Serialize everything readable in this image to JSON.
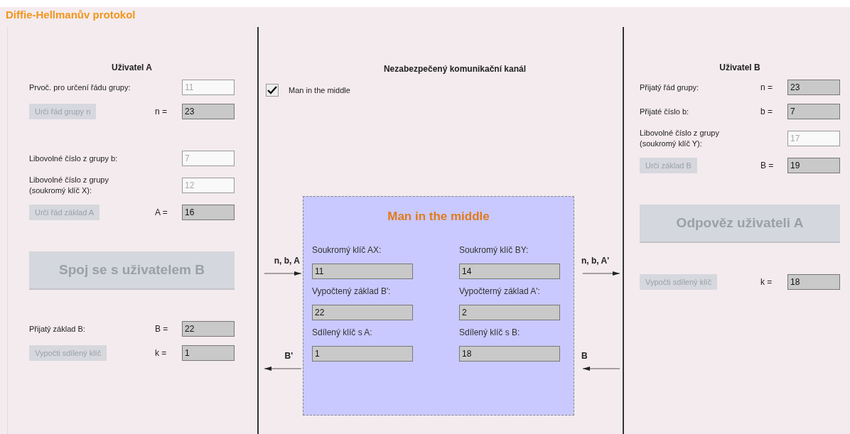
{
  "title": "Diffie-Hellmanův protokol",
  "user_a": {
    "heading": "Uživatel A",
    "sections": [
      [
        {
          "kind": "field",
          "label": "Prvoč. pro určení řádu grupy:",
          "value": "11",
          "editable": true
        },
        {
          "kind": "action",
          "button": "Urči řád grupy n",
          "disabled": true,
          "var": "n =",
          "value": "23",
          "editable": false
        }
      ],
      [
        {
          "kind": "field",
          "label": "Libovolné číslo z grupy b:",
          "value": "7",
          "editable": true
        },
        {
          "kind": "field",
          "label": "Libovolné číslo z grupy\n(soukromý klíč X):",
          "value": "12",
          "editable": true
        },
        {
          "kind": "action",
          "button": "Urči řád základ A",
          "disabled": true,
          "var": "A =",
          "value": "16",
          "editable": false
        }
      ],
      [
        {
          "kind": "big_button",
          "button": "Spoj se s uživatelem B",
          "disabled": true
        }
      ],
      [
        {
          "kind": "field",
          "label": "Přijatý základ B:",
          "var": "B =",
          "value": "22",
          "editable": false
        },
        {
          "kind": "action",
          "button": "Vypočti sdílený klíč",
          "disabled": true,
          "var": "k =",
          "value": "1",
          "editable": false
        }
      ]
    ]
  },
  "channel": {
    "heading": "Nezabezpečený komunikační kanál",
    "checkbox": {
      "label": "Man in the middle",
      "checked": true
    },
    "left_arrows": [
      {
        "label": "n, b, A",
        "kind": "rightward"
      },
      {
        "label": "B'",
        "kind": "leftward"
      }
    ],
    "right_arrows": [
      {
        "label": "n, b, A'",
        "kind": "rightward"
      },
      {
        "label": "B",
        "kind": "leftward"
      }
    ],
    "mitm": {
      "title": "Man in the middle",
      "fields": [
        {
          "label": "Soukromý klíč AX:",
          "value": "11"
        },
        {
          "label": "Soukromý klíč BY:",
          "value": "14"
        },
        {
          "label": "Vypočtený základ B':",
          "value": "22"
        },
        {
          "label": "Vypočterný základ A':",
          "value": "2"
        },
        {
          "label": "Sdílený klíč s A:",
          "value": "1"
        },
        {
          "label": "Sdílený klíč s B:",
          "value": "18"
        }
      ]
    }
  },
  "user_b": {
    "heading": "Uživatel B",
    "sections": [
      [
        {
          "kind": "field",
          "label": "Přijatý řád grupy:",
          "var": "n =",
          "value": "23",
          "editable": false
        },
        {
          "kind": "field",
          "label": "Přijaté číslo b:",
          "var": "b =",
          "value": "7",
          "editable": false
        },
        {
          "kind": "field",
          "label": "Libovolné číslo z grupy\n(soukromý klíč Y):",
          "value": "17",
          "editable": true
        },
        {
          "kind": "action",
          "button": "Urči základ B",
          "disabled": true,
          "var": "B =",
          "value": "19",
          "editable": false
        }
      ],
      [
        {
          "kind": "big_button",
          "button": "Odpověz uživateli A",
          "disabled": true
        }
      ],
      [
        {
          "kind": "action",
          "button": "Vypočti sdílený klíč",
          "disabled": true,
          "var": "k =",
          "value": "18",
          "editable": false
        }
      ]
    ]
  }
}
